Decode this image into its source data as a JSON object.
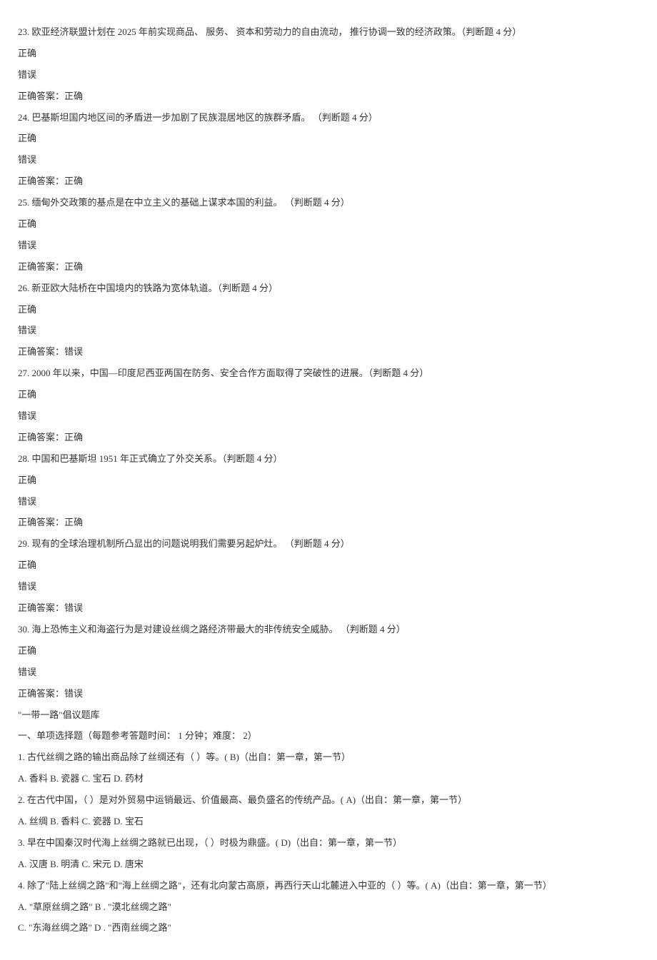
{
  "tf_questions": [
    {
      "num": "23",
      "text": ". 欧亚经济联盟计划在 2025 年前实现商品、 服务、 资本和劳动力的自由流动， 推行协调一致的经济政策。（判断题 4 分）",
      "opt_true": "正确",
      "opt_false": "错误",
      "answer": "正确答案：正确"
    },
    {
      "num": "24",
      "text": ". 巴基斯坦国内地区间的矛盾进一步加剧了民族混居地区的族群矛盾。 （判断题 4 分）",
      "opt_true": "正确",
      "opt_false": "错误",
      "answer": "正确答案：正确"
    },
    {
      "num": "25",
      "text": ". 缅甸外交政策的基点是在中立主义的基础上谋求本国的利益。 （判断题 4 分）",
      "opt_true": "正确",
      "opt_false": "错误",
      "answer": "正确答案：正确"
    },
    {
      "num": "26",
      "text": ". 新亚欧大陆桥在中国境内的铁路为宽体轨道。（判断题 4 分）",
      "opt_true": "正确",
      "opt_false": "错误",
      "answer": "正确答案：错误"
    },
    {
      "num": "27",
      "text": ". 2000 年以来，中国—印度尼西亚两国在防务、安全合作方面取得了突破性的进展。（判断题 4 分）",
      "opt_true": "正确",
      "opt_false": "错误",
      "answer": "正确答案：正确"
    },
    {
      "num": "28",
      "text": ". 中国和巴基斯坦 1951 年正式确立了外交关系。（判断题 4 分）",
      "opt_true": "正确",
      "opt_false": "错误",
      "answer": "正确答案：正确"
    },
    {
      "num": "29",
      "text": ". 现有的全球治理机制所凸显出的问题说明我们需要另起炉灶。 （判断题 4 分）",
      "opt_true": "正确",
      "opt_false": "错误",
      "answer": "正确答案：错误"
    },
    {
      "num": "30",
      "text": ". 海上恐怖主义和海盗行为是对建设丝绸之路经济带最大的非传统安全威胁。 （判断题 4 分）",
      "opt_true": "正确",
      "opt_false": "错误",
      "answer": "正确答案：错误"
    }
  ],
  "section_title": "\"一带一路\"倡议题库",
  "mc_header": "一、单项选择题（每题参考答题时间： 1 分钟；难度： 2）",
  "mc_questions": [
    {
      "num": "1",
      "text": ". 古代丝绸之路的输出商品除了丝绸还有（ ）等。( B)（出自：第一章，第一节）",
      "opts": "A. 香料 B. 瓷器 C. 宝石 D. 药材"
    },
    {
      "num": "2",
      "text": ". 在古代中国，（ ）是对外贸易中运销最远、价值最高、最负盛名的传统产品。( A)（出自：第一章，第一节）",
      "opts": "A. 丝绸 B. 香料 C. 瓷器 D. 宝石"
    },
    {
      "num": "3",
      "text": ". 早在中国秦汉时代海上丝绸之路就已出现，（ ）时极为鼎盛。( D)（出自：第一章，第一节）",
      "opts": "A. 汉唐 B. 明清 C. 宋元 D. 唐宋"
    },
    {
      "num": "4",
      "text": ". 除了\"陆上丝绸之路\"和\"海上丝绸之路\"，还有北向蒙古高原，再西行天山北麓进入中亚的（ ）等。( A)（出自：第一章，第一节）",
      "opts_line1": "A. \"草原丝绸之路\" B . \"漠北丝绸之路\"",
      "opts_line2": "C. \"东海丝绸之路\" D . \"西南丝绸之路\""
    }
  ]
}
